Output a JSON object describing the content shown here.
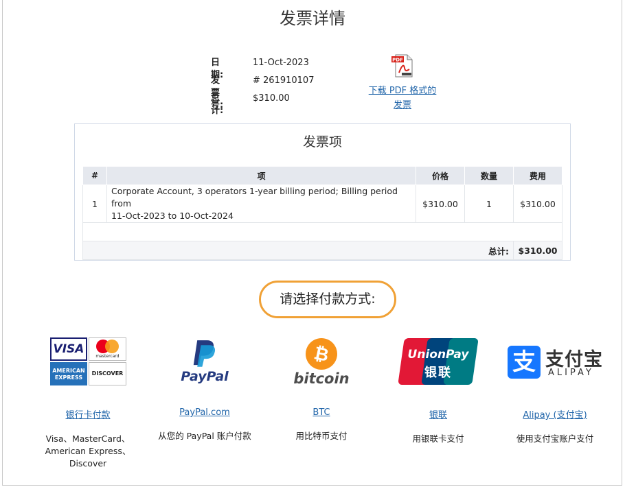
{
  "page": {
    "title": "发票详情"
  },
  "summary": {
    "date_label": "日期:",
    "date_value": "11-Oct-2023",
    "invoice_label": "发票号:",
    "invoice_value": "# 261910107",
    "total_label": "总计:",
    "total_value": "$310.00"
  },
  "pdf": {
    "link_line1": "下载 PDF 格式的",
    "link_line2": "发票",
    "icon_text": "PDF"
  },
  "items": {
    "title": "发票项",
    "columns": [
      "#",
      "项",
      "价格",
      "数量",
      "费用"
    ],
    "rows": [
      {
        "num": "1",
        "desc_line1": "Corporate Account, 3 operators 1-year billing period; Billing period from",
        "desc_line2": "11-Oct-2023 to 10-Oct-2024",
        "price": "$310.00",
        "qty": "1",
        "cost": "$310.00"
      }
    ],
    "total_label": "总计:",
    "total_value": "$310.00"
  },
  "payment": {
    "prompt": "请选择付款方式:",
    "methods": [
      {
        "id": "card",
        "link": "银行卡付款",
        "desc_lines": [
          "Visa、MasterCard、",
          "American Express、",
          "Discover"
        ],
        "logo_texts": [
          "VISA",
          "mastercard",
          "AMERICAN",
          "EXPRESS",
          "DISCOVER"
        ]
      },
      {
        "id": "paypal",
        "link": "PayPal.com",
        "desc_lines": [
          "从您的 PayPal 账户付款"
        ],
        "logo_texts": [
          "PayPal"
        ]
      },
      {
        "id": "btc",
        "link": "BTC",
        "desc_lines": [
          "用比特币支付"
        ],
        "logo_texts": [
          "bitcoin"
        ]
      },
      {
        "id": "unionpay",
        "link": "银联",
        "desc_lines": [
          "用银联卡支付"
        ],
        "logo_texts": [
          "UnionPay",
          "银联"
        ]
      },
      {
        "id": "alipay",
        "link": "Alipay (支付宝)",
        "desc_lines": [
          "使用支付宝账户支付"
        ],
        "logo_texts": [
          "支付宝",
          "ALIPAY"
        ]
      }
    ]
  },
  "colors": {
    "link": "#2266aa",
    "accent_orange": "#f0a136",
    "table_header": "#e5e8ee",
    "bitcoin": "#f7931a",
    "alipay": "#1677ff",
    "paypal_dark": "#253b80",
    "paypal_light": "#179bd7"
  }
}
